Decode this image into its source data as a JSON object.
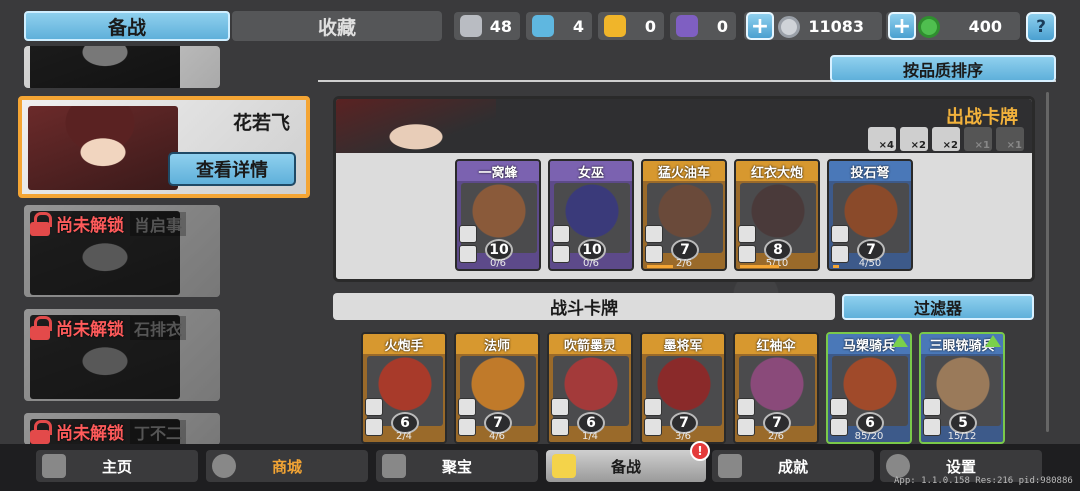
{
  "tabs": {
    "prepare": "备战",
    "collection": "收藏"
  },
  "resources": [
    {
      "name": "silver-shield",
      "value": "48",
      "color": "#b9bcc2"
    },
    {
      "name": "crystal-shield",
      "value": "4",
      "color": "#5fb7e0"
    },
    {
      "name": "gold-shield",
      "value": "0",
      "color": "#f0b52a"
    },
    {
      "name": "purple-shield",
      "value": "0",
      "color": "#7f5fc2"
    }
  ],
  "coins": "11083",
  "gems": "400",
  "help": "?",
  "heroes": {
    "selected_name": "花若飞",
    "detail_btn": "查看详情",
    "locked_text": "尚未解锁",
    "locked": [
      {
        "name": "肖启事"
      },
      {
        "name": "石排衣"
      },
      {
        "name": "丁不二"
      }
    ]
  },
  "sort_btn": "按品质排序",
  "battle_cards_title": "出战卡牌",
  "limits": [
    "×4",
    "×2",
    "×2",
    "×1",
    "×1"
  ],
  "battle_cards": [
    {
      "name": "一窝蜂",
      "level": "10",
      "count": "0/6",
      "progress": 0,
      "rarity": "purple",
      "art": "#8a5a3a"
    },
    {
      "name": "女巫",
      "level": "10",
      "count": "0/6",
      "progress": 0,
      "rarity": "purple",
      "art": "#3a3a7a"
    },
    {
      "name": "猛火油车",
      "level": "7",
      "count": "2/6",
      "progress": 0.33,
      "rarity": "orange",
      "art": "#6a4a3a"
    },
    {
      "name": "红衣大炮",
      "level": "8",
      "count": "5/10",
      "progress": 0.5,
      "rarity": "orange",
      "art": "#4a3a3a"
    },
    {
      "name": "投石弩",
      "level": "7",
      "count": "4/50",
      "progress": 0.08,
      "rarity": "blue",
      "art": "#8a4a2a"
    }
  ],
  "combat_cards_title": "战斗卡牌",
  "filter_btn": "过滤器",
  "combat_cards": [
    {
      "name": "火炮手",
      "level": "6",
      "count": "2/4",
      "rarity": "orange",
      "art": "#a83a2a",
      "upgrade": false
    },
    {
      "name": "法师",
      "level": "7",
      "count": "4/6",
      "rarity": "orange",
      "art": "#c07a2a",
      "upgrade": false
    },
    {
      "name": "吹箭墨灵",
      "level": "6",
      "count": "1/4",
      "rarity": "orange",
      "art": "#a33a3a",
      "upgrade": false
    },
    {
      "name": "墨将军",
      "level": "7",
      "count": "3/6",
      "rarity": "orange",
      "art": "#8a2a2a",
      "upgrade": false
    },
    {
      "name": "红袖伞",
      "level": "7",
      "count": "2/6",
      "rarity": "orange",
      "art": "#8a4a7a",
      "upgrade": false
    },
    {
      "name": "马槊骑兵",
      "level": "6",
      "count": "85/20",
      "rarity": "blue",
      "art": "#a04a2a",
      "upgrade": true
    },
    {
      "name": "三眼铳骑兵",
      "level": "5",
      "count": "15/12",
      "rarity": "blue",
      "art": "#9a7a5a",
      "upgrade": true
    }
  ],
  "nav": [
    {
      "label": "主页",
      "icon": "home-icon"
    },
    {
      "label": "商城",
      "icon": "shop-icon"
    },
    {
      "label": "聚宝",
      "icon": "treasure-icon"
    },
    {
      "label": "备战",
      "icon": "deck-icon"
    },
    {
      "label": "成就",
      "icon": "achievement-icon"
    },
    {
      "label": "设置",
      "icon": "settings-gear-icon"
    }
  ],
  "alert": "!",
  "version": "App: 1.1.0.158 Res:216 pid:980886"
}
